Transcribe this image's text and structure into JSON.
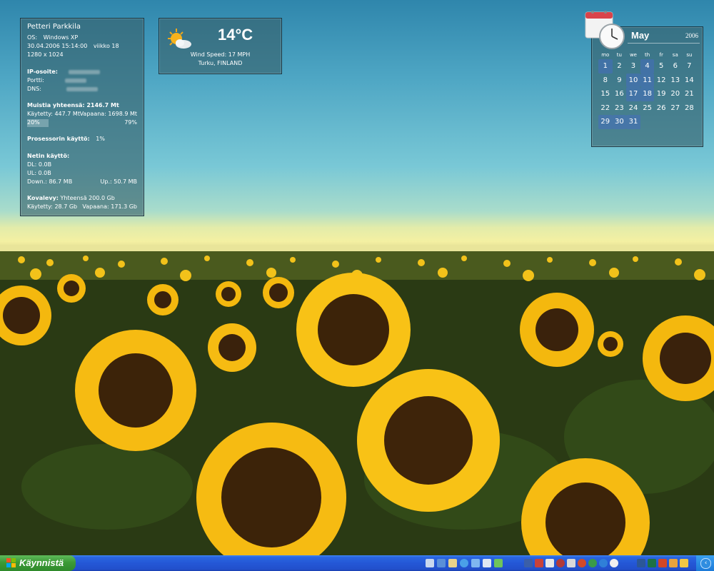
{
  "system_info": {
    "user_name": "Petteri Parkkila",
    "os_label": "OS:",
    "os_value": "Windows XP",
    "datetime": "30.04.2006 15:14:00",
    "week": "viikko 18",
    "resolution": "1280 x 1024",
    "ip_label": "IP-osoite:",
    "port_label": "Portti:",
    "dns_label": "DNS:",
    "memory_total_label": "Muistia yhteensä: 2146.7 Mt",
    "memory_used": "Käytetty: 447.7 Mt",
    "memory_free": "Vapaana: 1698.9 Mt",
    "memory_used_pct": "20%",
    "memory_free_pct": "79%",
    "cpu_label": "Prosessorin käyttö:",
    "cpu_value": "1%",
    "net_label": "Netin käyttö:",
    "net_dl": "DL: 0.0B",
    "net_ul": "UL: 0.0B",
    "net_down": "Down.: 86.7 MB",
    "net_up": "Up.: 50.7 MB",
    "disk_label": "Kovalevy:",
    "disk_total": "Yhteensä 200.0 Gb",
    "disk_used": "Käytetty: 28.7 Gb",
    "disk_free": "Vapaana: 171.3 Gb"
  },
  "weather": {
    "temperature": "14°C",
    "wind": "Wind Speed: 17 MPH",
    "location": "Turku, FINLAND",
    "icon": "partly-cloudy-icon"
  },
  "calendar": {
    "month": "May",
    "year": "2006",
    "weekdays": [
      "mo",
      "tu",
      "we",
      "th",
      "fr",
      "sa",
      "su"
    ],
    "days": [
      "1",
      "2",
      "3",
      "4",
      "5",
      "6",
      "7",
      "8",
      "9",
      "10",
      "11",
      "12",
      "13",
      "14",
      "15",
      "16",
      "17",
      "18",
      "19",
      "20",
      "21",
      "22",
      "23",
      "24",
      "25",
      "26",
      "27",
      "28",
      "29",
      "30",
      "31"
    ],
    "event_days": [
      "1",
      "4",
      "10",
      "11",
      "17",
      "18",
      "29",
      "30",
      "31"
    ]
  },
  "taskbar": {
    "start_label": "Käynnistä",
    "accent": "#2457d6",
    "start_color": "#3c9a36"
  }
}
